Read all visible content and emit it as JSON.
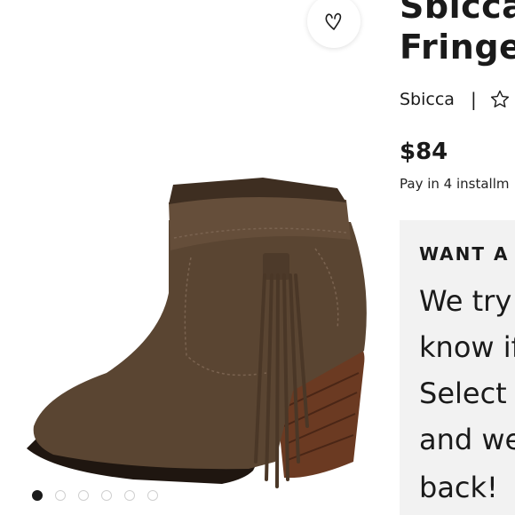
{
  "product": {
    "title_line1": "Sbicca",
    "title_line2": "Fringe",
    "brand": "Sbicca",
    "separator": "|",
    "price": "$84",
    "installments": "Pay in 4 installm"
  },
  "icons": {
    "like": "heart-icon",
    "rating": "star-outline-icon"
  },
  "gallery": {
    "image_count": 6,
    "active_index": 0
  },
  "notice": {
    "heading": "WANT A F",
    "lines": [
      "We try",
      "know if",
      "Select",
      "and we",
      "back!"
    ]
  },
  "colors": {
    "text": "#1a1a1a",
    "panel_bg": "#f2f2f2",
    "dot_inactive": "#d0d0d0"
  }
}
